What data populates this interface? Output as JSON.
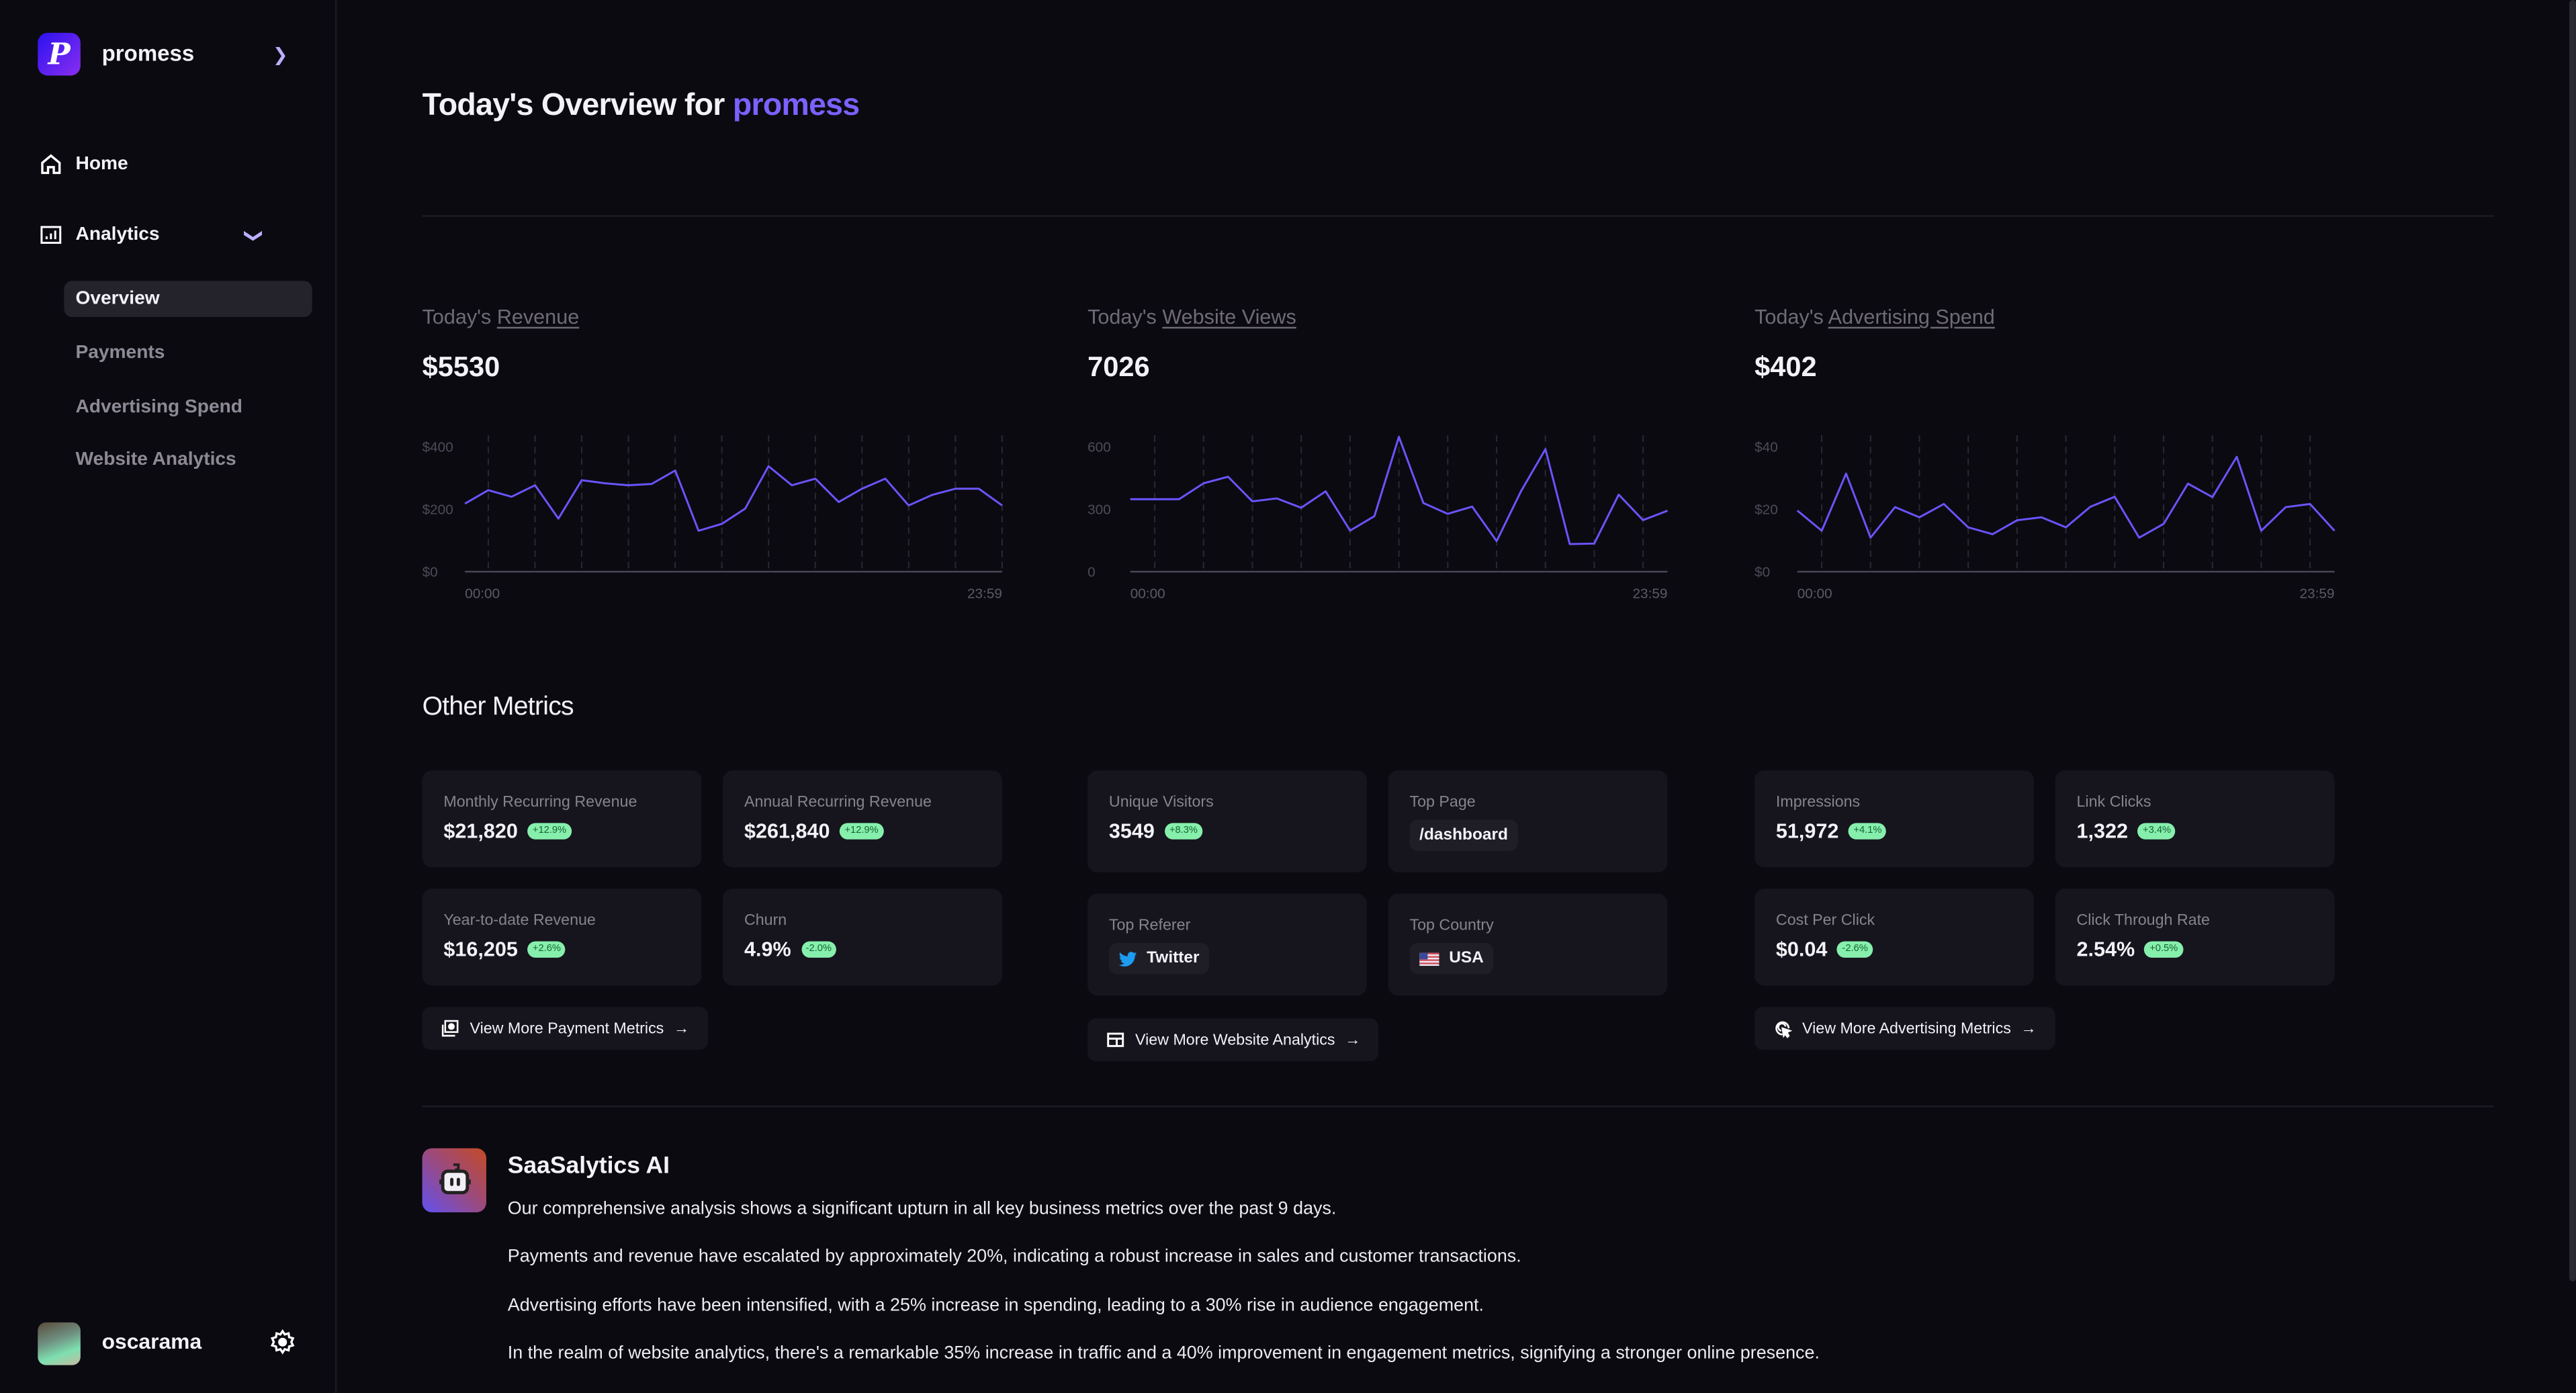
{
  "sidebar": {
    "org_name": "promess",
    "logo_letter": "P",
    "nav": [
      {
        "label": "Home",
        "icon": "home-icon"
      },
      {
        "label": "Analytics",
        "icon": "bar-chart-icon"
      }
    ],
    "analytics_items": [
      {
        "label": "Overview",
        "active": true
      },
      {
        "label": "Payments",
        "active": false
      },
      {
        "label": "Advertising Spend",
        "active": false
      },
      {
        "label": "Website Analytics",
        "active": false
      }
    ],
    "user": {
      "name": "oscarama"
    }
  },
  "header": {
    "title_prefix": "Today's Overview for",
    "title_org": "promess"
  },
  "today": [
    {
      "prefix": "Today's",
      "link": "Revenue",
      "value": "$5530"
    },
    {
      "prefix": "Today's",
      "link": "Website Views",
      "value": "7026"
    },
    {
      "prefix": "Today's",
      "link": "Advertising Spend",
      "value": "$402"
    }
  ],
  "chart_data": [
    {
      "type": "line",
      "title": "Today's Revenue",
      "x_labels": [
        "00:00",
        "23:59"
      ],
      "y_ticks": [
        "$0",
        "$200",
        "$400"
      ],
      "ylim": [
        0,
        400
      ],
      "grid": "vertical dashed",
      "color": "#6a55ff",
      "values": [
        218,
        261,
        240,
        277,
        170,
        293,
        283,
        277,
        281,
        324,
        131,
        153,
        202,
        338,
        277,
        298,
        223,
        266,
        298,
        212,
        246,
        266,
        266,
        212
      ]
    },
    {
      "type": "line",
      "title": "Today's Website Views",
      "x_labels": [
        "00:00",
        "23:59"
      ],
      "y_ticks": [
        "0",
        "300",
        "600"
      ],
      "ylim": [
        0,
        600
      ],
      "grid": "vertical dashed",
      "color": "#6a55ff",
      "values": [
        348,
        348,
        348,
        425,
        456,
        338,
        352,
        307,
        386,
        197,
        267,
        648,
        330,
        278,
        313,
        147,
        386,
        589,
        133,
        135,
        370,
        248,
        293
      ]
    },
    {
      "type": "line",
      "title": "Today's Advertising Spend",
      "x_labels": [
        "00:00",
        "23:59"
      ],
      "y_ticks": [
        "$0",
        "$20",
        "$40"
      ],
      "ylim": [
        0,
        40
      ],
      "grid": "vertical dashed",
      "color": "#6a55ff",
      "values": [
        19.6,
        13.1,
        31.4,
        10.9,
        20.7,
        17.4,
        21.7,
        14.2,
        12.0,
        16.5,
        17.4,
        14.2,
        20.8,
        24.0,
        10.9,
        15.3,
        28.2,
        23.9,
        36.8,
        13.1,
        20.7,
        21.7,
        13.1
      ]
    }
  ],
  "other_metrics": {
    "heading": "Other Metrics",
    "payments": {
      "cards": [
        {
          "label": "Monthly Recurring Revenue",
          "value": "$21,820",
          "change": "+12.9%"
        },
        {
          "label": "Annual Recurring Revenue",
          "value": "$261,840",
          "change": "+12.9%"
        },
        {
          "label": "Year-to-date Revenue",
          "value": "$16,205",
          "change": "+2.6%"
        },
        {
          "label": "Churn",
          "value": "4.9%",
          "change": "-2.0%"
        }
      ],
      "button": "View More Payment Metrics"
    },
    "website": {
      "unique_visitors": {
        "label": "Unique Visitors",
        "value": "3549",
        "change": "+8.3%"
      },
      "top_page": {
        "label": "Top Page",
        "value": "/dashboard"
      },
      "top_referer": {
        "label": "Top Referer",
        "value": "Twitter"
      },
      "top_country": {
        "label": "Top Country",
        "value": "USA"
      },
      "button": "View More Website Analytics"
    },
    "advertising": {
      "cards": [
        {
          "label": "Impressions",
          "value": "51,972",
          "change": "+4.1%"
        },
        {
          "label": "Link Clicks",
          "value": "1,322",
          "change": "+3.4%"
        },
        {
          "label": "Cost Per Click",
          "value": "$0.04",
          "change": "-2.6%"
        },
        {
          "label": "Click Through Rate",
          "value": "2.54%",
          "change": "+0.5%"
        }
      ],
      "button": "View More Advertising Metrics"
    }
  },
  "ai": {
    "title": "SaaSalytics AI",
    "paragraphs": [
      "Our comprehensive analysis shows a significant upturn in all key business metrics over the past 9 days.",
      "Payments and revenue have escalated by approximately 20%, indicating a robust increase in sales and customer transactions.",
      "Advertising efforts have been intensified, with a 25% increase in spending, leading to a 30% rise in audience engagement.",
      "In the realm of website analytics, there's a remarkable 35% increase in traffic and a 40% improvement in engagement metrics, signifying a stronger online presence."
    ]
  },
  "colors": {
    "accent": "#7b61ff",
    "background": "#0c0a11",
    "card": "#16151d",
    "badge": "#86efac"
  }
}
